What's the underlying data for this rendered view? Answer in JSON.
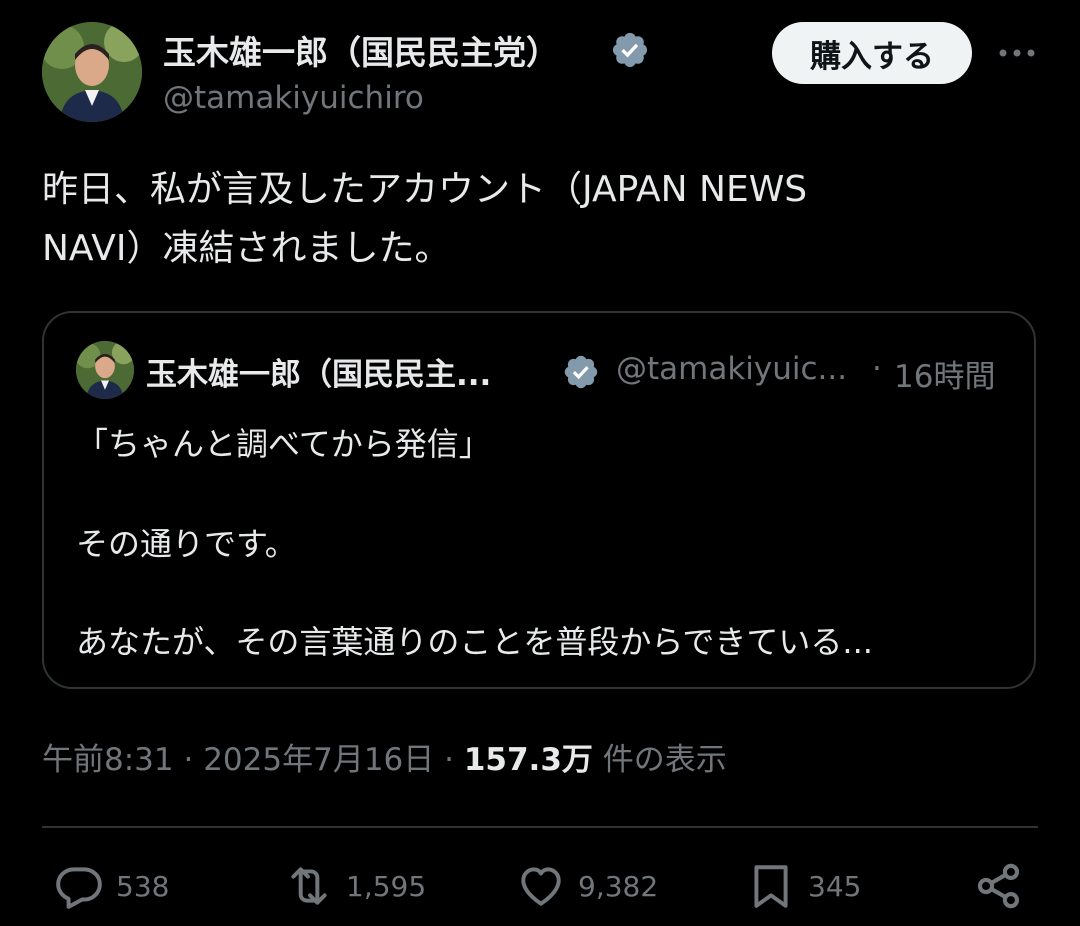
{
  "author": {
    "display_name": "玉木雄一郎（国民民主党）",
    "handle": "@tamakiyuichiro",
    "verified_icon": "verified-badge-icon",
    "verified_color": "#829aab"
  },
  "header": {
    "buy_label": "購入する",
    "more_icon": "more-dots-icon"
  },
  "tweet": {
    "line1": "昨日、私が言及したアカウント（JAPAN NEWS",
    "line2": "NAVI）凍結されました。"
  },
  "quote": {
    "display_name": "玉木雄一郎（国民民主...",
    "handle": "@tamakiyuic...",
    "separator": "·",
    "time": "16時間",
    "lines": [
      "「ちゃんと調べてから発信」",
      "その通りです。",
      "あなたが、その言葉通りのことを普段からできている..."
    ]
  },
  "meta": {
    "time": "午前8:31",
    "date": "2025年7月16日",
    "views_count": "157.3万",
    "views_label": "件の表示"
  },
  "actions": {
    "replies": "538",
    "reposts": "1,595",
    "likes": "9,382",
    "bookmarks": "345"
  },
  "colors": {
    "background": "#000000",
    "text": "#e7e9ea",
    "secondary": "#71767b",
    "border": "#2f3336",
    "button_bg": "#eff3f4"
  }
}
